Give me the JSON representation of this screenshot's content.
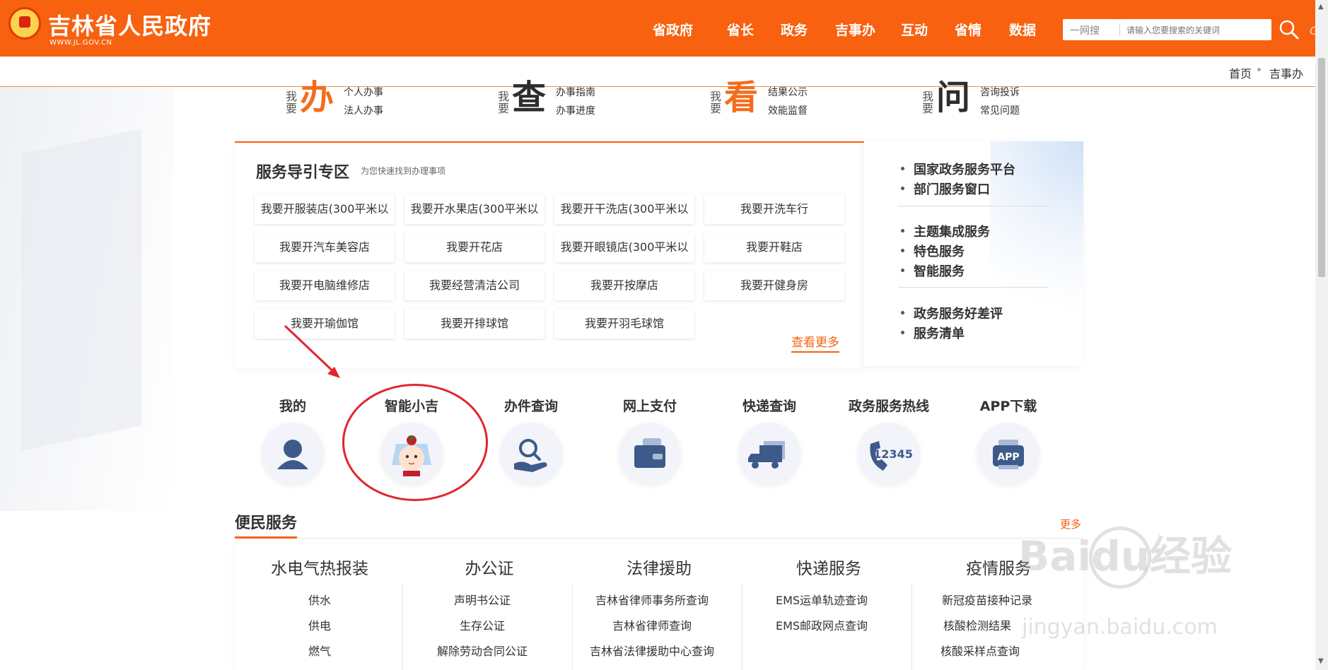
{
  "header": {
    "title": "吉林省人民政府",
    "url": "WWW.JL.GOV.CN",
    "nav": [
      "省政府",
      "省长",
      "政务",
      "吉事办",
      "互动",
      "省情",
      "数据"
    ],
    "search": {
      "scope": "一网搜",
      "placeholder": "请输入您要搜索的关键词"
    }
  },
  "breadcrumb": [
    "首页",
    "吉事办"
  ],
  "want_blocks": [
    {
      "small": "我要",
      "big": "办",
      "links": [
        "个人办事",
        "法人办事"
      ]
    },
    {
      "small": "我要",
      "big": "查",
      "links": [
        "办事指南",
        "办事进度"
      ]
    },
    {
      "small": "我要",
      "big": "看",
      "links": [
        "结果公示",
        "效能监督"
      ]
    },
    {
      "small": "我要",
      "big": "问",
      "links": [
        "咨询投诉",
        "常见问题"
      ]
    }
  ],
  "guide": {
    "title": "服务导引专区",
    "subtitle": "为您快速找到办理事项",
    "items": [
      "我要开服装店(300平米以",
      "我要开水果店(300平米以",
      "我要开干洗店(300平米以",
      "我要开洗车行",
      "我要开汽车美容店",
      "我要开花店",
      "我要开眼镜店(300平米以",
      "我要开鞋店",
      "我要开电脑维修店",
      "我要经营清洁公司",
      "我要开按摩店",
      "我要开健身房",
      "我要开瑜伽馆",
      "我要开排球馆",
      "我要开羽毛球馆"
    ],
    "more": "查看更多"
  },
  "right_panel": {
    "group1": [
      "国家政务服务平台",
      "部门服务窗口"
    ],
    "group2": [
      "主题集成服务",
      "特色服务",
      "智能服务"
    ],
    "group3": [
      "政务服务好差评",
      "服务清单"
    ]
  },
  "quick_services": [
    {
      "label": "我的",
      "icon": "user-icon"
    },
    {
      "label": "智能小吉",
      "icon": "baby-avatar-icon"
    },
    {
      "label": "办件查询",
      "icon": "search-hand-icon"
    },
    {
      "label": "网上支付",
      "icon": "wallet-icon"
    },
    {
      "label": "快递查询",
      "icon": "truck-icon"
    },
    {
      "label": "政务服务热线",
      "icon": "phone-12345-icon"
    },
    {
      "label": "APP下载",
      "icon": "app-icon"
    }
  ],
  "hotline_number": "12345",
  "app_text": "APP",
  "convenience": {
    "title": "便民服务",
    "more": "更多",
    "columns": [
      {
        "title": "水电气热报装",
        "items": [
          "供水",
          "供电",
          "燃气"
        ]
      },
      {
        "title": "办公证",
        "items": [
          "声明书公证",
          "生存公证",
          "解除劳动合同公证"
        ]
      },
      {
        "title": "法律援助",
        "items": [
          "吉林省律师事务所查询",
          "吉林省律师查询",
          "吉林省法律援助中心查询"
        ]
      },
      {
        "title": "快递服务",
        "items": [
          "EMS运单轨迹查询",
          "EMS邮政网点查询"
        ]
      },
      {
        "title": "疫情服务",
        "items": [
          "新冠疫苗接种记录",
          "核酸检测结果",
          "核酸采样点查询"
        ]
      }
    ]
  },
  "watermark": {
    "logo": "Baidu经验",
    "url": "jingyan.baidu.com"
  },
  "colors": {
    "brand": "#f7610f",
    "annotation": "#e0262f"
  }
}
